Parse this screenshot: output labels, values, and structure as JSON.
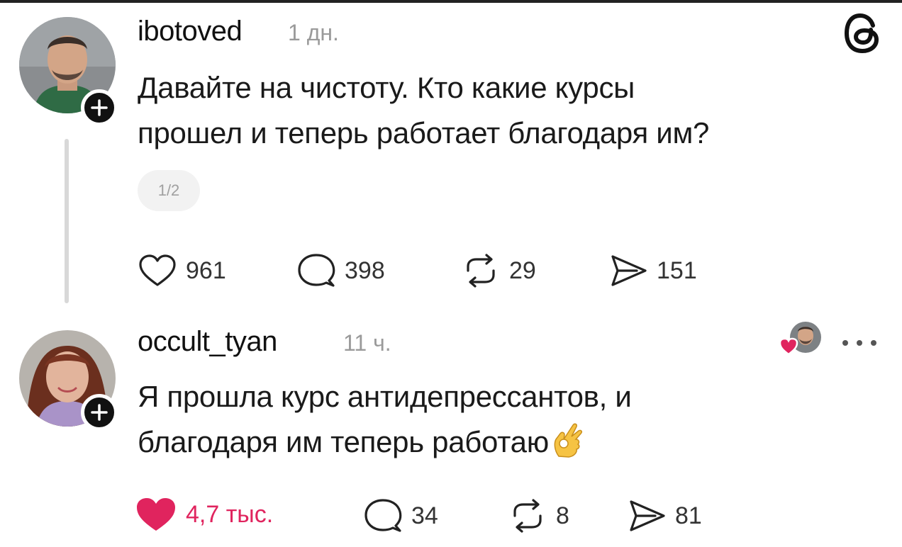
{
  "posts": [
    {
      "username": "ibotoved",
      "time": "1 дн.",
      "text_line1": "Давайте на чистоту. Кто какие курсы",
      "text_line2": "прошел и теперь работает благодаря им?",
      "pager": "1/2",
      "likes": "961",
      "replies": "398",
      "reposts": "29",
      "shares": "151",
      "liked": false
    },
    {
      "username": "occult_tyan",
      "time": "11 ч.",
      "text_line1": "Я прошла курс антидепрессантов, и",
      "text_line2": "благодаря им теперь работаю",
      "emoji_icon": "ok-hand-icon",
      "likes": "4,7 тыс.",
      "replies": "34",
      "reposts": "8",
      "shares": "81",
      "liked": true
    }
  ],
  "colors": {
    "like_red": "#e0245e",
    "muted": "#9a9a9a",
    "text": "#111111"
  },
  "icons": {
    "brand": "threads-logo-icon",
    "follow": "plus-icon",
    "like": "heart-icon",
    "reply": "speech-bubble-icon",
    "repost": "repost-arrows-icon",
    "share": "send-arrow-icon",
    "more": "more-dots-icon"
  }
}
